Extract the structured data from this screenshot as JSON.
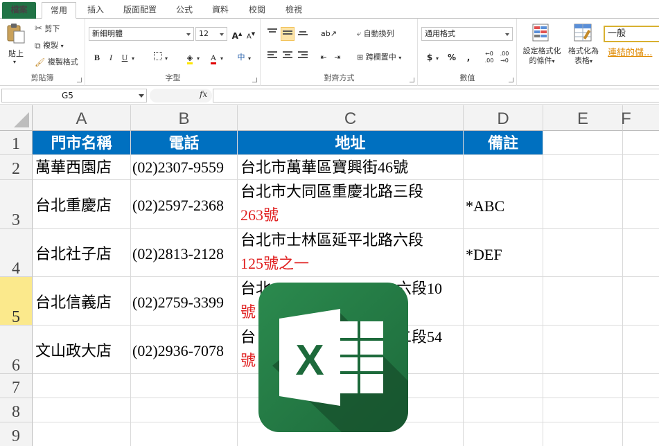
{
  "tabs": {
    "file": "檔案",
    "home": "常用",
    "insert": "插入",
    "layout": "版面配置",
    "formulas": "公式",
    "data": "資料",
    "review": "校閱",
    "view": "檢視"
  },
  "ribbon": {
    "clipboard": {
      "paste": "貼上",
      "cut": "剪下",
      "copy": "複製",
      "format_painter": "複製格式",
      "label": "剪貼簿"
    },
    "font": {
      "name": "新細明體",
      "size": "12",
      "label": "字型",
      "bold": "B",
      "italic": "I",
      "underline": "U"
    },
    "alignment": {
      "wrap": "自動換列",
      "merge": "跨欄置中",
      "label": "對齊方式"
    },
    "number": {
      "format": "通用格式",
      "label": "數值"
    },
    "styles": {
      "conditional": [
        "設定格式化",
        "的條件"
      ],
      "as_table": [
        "格式化為",
        "表格"
      ],
      "normal": "一般",
      "hyperlink": "連結的儲..."
    }
  },
  "formula_bar": {
    "name_box": "G5",
    "fx": "fx",
    "content": ""
  },
  "columns": [
    "A",
    "B",
    "C",
    "D",
    "E",
    "F"
  ],
  "rows": [
    "1",
    "2",
    "3",
    "4",
    "5",
    "6",
    "7",
    "8",
    "9"
  ],
  "selected_row": "5",
  "header_row": [
    "門市名稱",
    "電話",
    "地址",
    "備註"
  ],
  "data_rows": [
    {
      "name": "萬華西園店",
      "phone": "(02)2307-9559",
      "addr1": "台北市萬華區寶興街46號",
      "addr2": "",
      "note": ""
    },
    {
      "name": "台北重慶店",
      "phone": "(02)2597-2368",
      "addr1": "台北市大同區重慶北路三段",
      "addr2": "263號",
      "note": "*ABC"
    },
    {
      "name": "台北社子店",
      "phone": "(02)2813-2128",
      "addr1": "台北市士林區延平北路六段",
      "addr2": "125號之一",
      "note": "*DEF"
    },
    {
      "name": "台北信義店",
      "phone": "(02)2759-3399",
      "addr1": "台北",
      "addr1_end": "六段10",
      "addr2": "號",
      "note": ""
    },
    {
      "name": "文山政大店",
      "phone": "(02)2936-7078",
      "addr1": "台",
      "addr1_end": "二段54",
      "addr2": "號",
      "note": ""
    }
  ],
  "colors": {
    "header_fill": "#0070c0",
    "accent": "#217346",
    "red_text": "#e02020"
  },
  "overlay_logo": "excel-logo"
}
